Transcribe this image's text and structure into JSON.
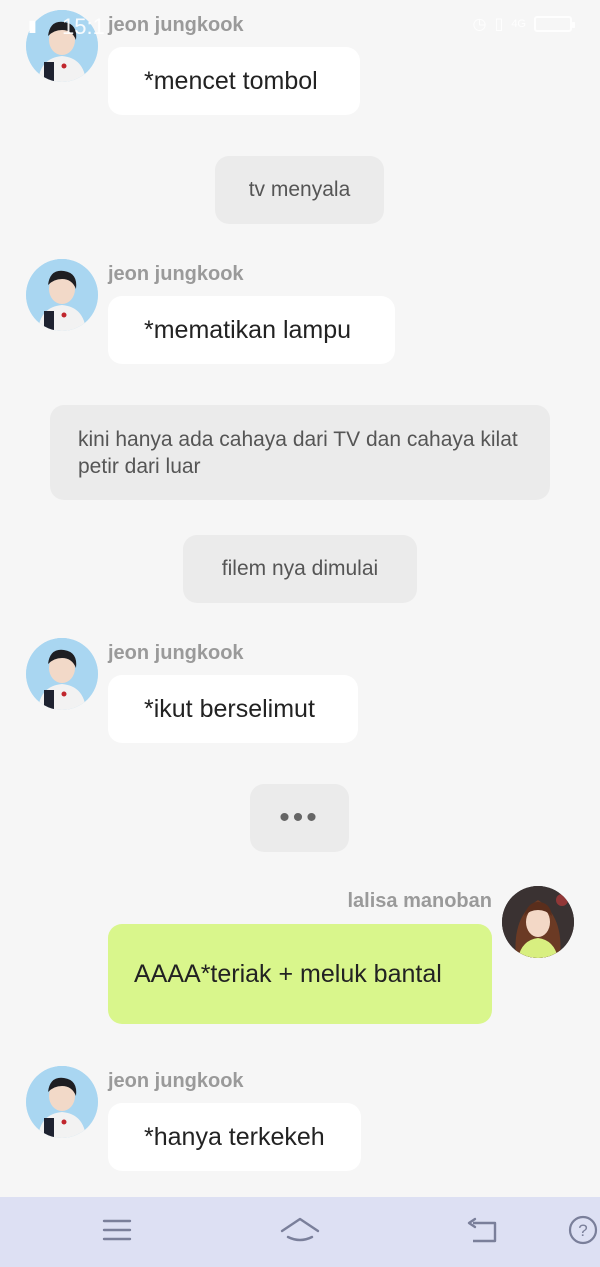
{
  "status_bar": {
    "time": "15:1",
    "network": "4G"
  },
  "messages": [
    {
      "type": "char",
      "sender": "jeon jungkook",
      "text": "*mencet tombol"
    },
    {
      "type": "narration",
      "text": "tv menyala"
    },
    {
      "type": "char",
      "sender": "jeon jungkook",
      "text": "*mematikan lampu"
    },
    {
      "type": "narration",
      "text": "kini hanya ada cahaya dari TV dan cahaya kilat petir dari luar"
    },
    {
      "type": "narration",
      "text": "filem nya dimulai"
    },
    {
      "type": "char",
      "sender": "jeon jungkook",
      "text": "*ikut berselimut"
    },
    {
      "type": "typing",
      "text": "•••"
    },
    {
      "type": "user",
      "sender": "lalisa manoban",
      "text": "AAAA*teriak + meluk bantal"
    },
    {
      "type": "char",
      "sender": "jeon jungkook",
      "text": "*hanya terkekeh"
    }
  ],
  "colors": {
    "background": "#f6f6f6",
    "char_bubble": "#ffffff",
    "narration_bubble": "#ebebeb",
    "user_bubble": "#d9f68c",
    "nav_bar": "#dde0f3"
  },
  "nav_bar": {
    "items": [
      "menu-icon",
      "home-icon",
      "back-icon",
      "help-icon"
    ]
  }
}
